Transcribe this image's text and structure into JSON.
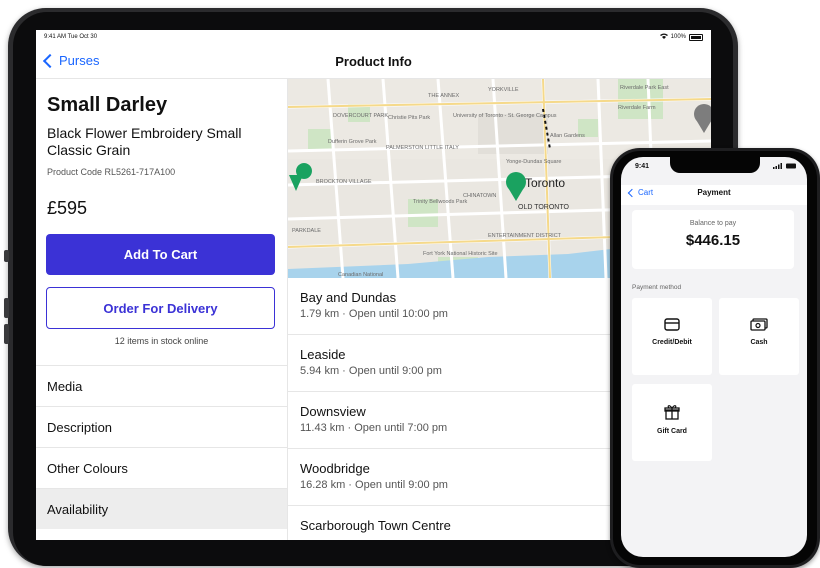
{
  "ipad": {
    "status": {
      "time": "9:41 AM  Tue Oct 30",
      "battery": "100%"
    },
    "nav": {
      "back_label": "Purses",
      "title": "Product Info"
    },
    "product": {
      "name": "Small Darley",
      "description": "Black Flower Embroidery Small Classic Grain",
      "code": "Product Code RL5261-717A100",
      "price": "£595",
      "add_to_cart": "Add To Cart",
      "order_delivery": "Order For Delivery",
      "stock": "12 items in stock online"
    },
    "menu": [
      "Media",
      "Description",
      "Other Colours",
      "Availability"
    ],
    "map_labels": [
      "THE ANNEX",
      "YORKVILLE",
      "DOVERCOURT PARK",
      "Christie Pits Park",
      "University of Toronto - St. George Campus",
      "Riverdale Park East",
      "Riverdale Farm",
      "Dufferin Grove Park",
      "PALMERSTON LITTLE ITALY",
      "Allan Gardens",
      "Yonge-Dundas Square",
      "BROCKTON VILLAGE",
      "CHINATOWN",
      "Toronto",
      "OLD TORONTO",
      "Trinity Bellwoods Park",
      "PARKDALE",
      "ENTERTAINMENT DISTRICT",
      "Fort York National Historic Site",
      "Canadian National"
    ],
    "stores": [
      {
        "name": "Bay and Dundas",
        "detail": "1.79 km  ·  Open until 10:00 pm"
      },
      {
        "name": "Leaside",
        "detail": "5.94 km  ·  Open until 9:00 pm"
      },
      {
        "name": "Downsview",
        "detail": "11.43 km  ·  Open until 7:00 pm"
      },
      {
        "name": "Woodbridge",
        "detail": "16.28 km  ·  Open until 9:00 pm"
      },
      {
        "name": "Scarborough Town Centre",
        "detail": ""
      }
    ],
    "accent": "#3b32d6",
    "link_color": "#1a66ff"
  },
  "iphone": {
    "status": {
      "time": "9:41"
    },
    "nav": {
      "back_label": "Cart",
      "title": "Payment"
    },
    "balance_label": "Balance to pay",
    "balance_amount": "$446.15",
    "payment_label": "Payment method",
    "methods": [
      {
        "label": "Credit/Debit",
        "icon": "credit-card-icon"
      },
      {
        "label": "Cash",
        "icon": "cash-icon"
      },
      {
        "label": "Gift Card",
        "icon": "gift-icon"
      }
    ]
  }
}
